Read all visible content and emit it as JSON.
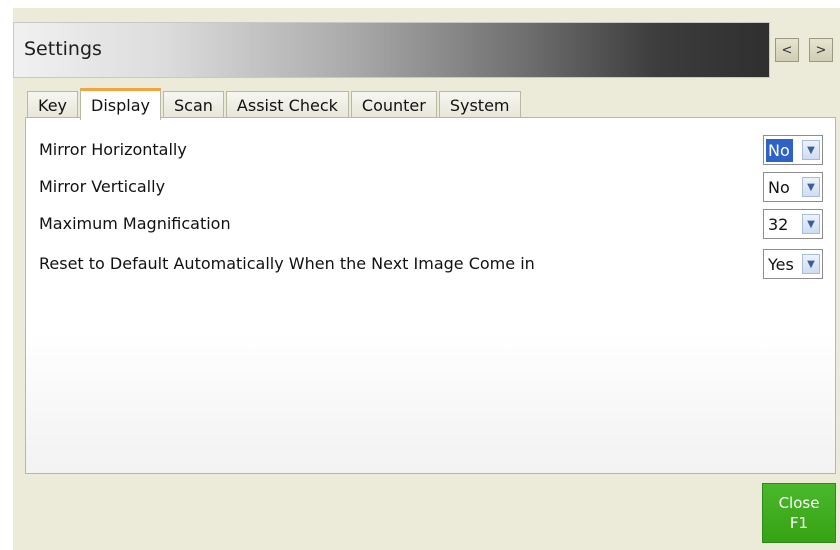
{
  "window": {
    "title": "Settings",
    "nav_prev": "<",
    "nav_next": ">"
  },
  "tabs": [
    {
      "label": "Key",
      "active": false
    },
    {
      "label": "Display",
      "active": true
    },
    {
      "label": "Scan",
      "active": false
    },
    {
      "label": "Assist Check",
      "active": false
    },
    {
      "label": "Counter",
      "active": false
    },
    {
      "label": "System",
      "active": false
    }
  ],
  "settings": [
    {
      "label": "Mirror Horizontally",
      "value": "No"
    },
    {
      "label": "Mirror Vertically",
      "value": "No"
    },
    {
      "label": "Maximum Magnification",
      "value": "32"
    },
    {
      "label": "Reset to Default Automatically When the Next Image Come in",
      "value": "Yes"
    }
  ],
  "footer": {
    "close_label": "Close",
    "close_shortcut": "F1"
  },
  "colors": {
    "active_tab_accent": "#f2a53d",
    "selection_highlight": "#2d63c8",
    "close_button": "#3fae1f",
    "window_background": "#ecebd9"
  }
}
